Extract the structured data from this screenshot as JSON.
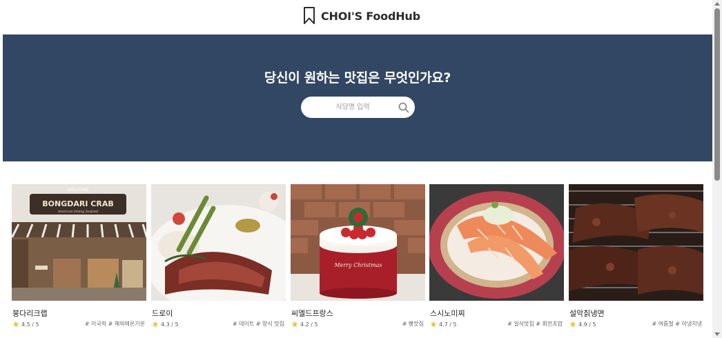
{
  "header": {
    "brand": "CHOI'S FoodHub",
    "brand_icon": "bookmark-icon"
  },
  "hero": {
    "title": "당신이 원하는 맛집은 무엇인가요?",
    "search_placeholder": "식당명 입력",
    "search_icon": "search-icon",
    "background": "#324763"
  },
  "restaurants": [
    {
      "name": "붕다리크랩",
      "rating": "4.5 / 5",
      "tags": "# 이국적 # 해외에온기분",
      "image_sign": "BONGDARI CRAB",
      "image_sign_top": "WELCOME",
      "image_sign_sub": "American Dining Seafood"
    },
    {
      "name": "드로이",
      "rating": "4.3 / 5",
      "tags": "# 데이트 # 양식 맛집"
    },
    {
      "name": "씨엘드프랑스",
      "rating": "4.2 / 5",
      "tags": "# 빵맛집",
      "image_text": "Merry Christmas"
    },
    {
      "name": "스시노미찌",
      "rating": "4.7 / 5",
      "tags": "# 일식맛집 # 회전초밥"
    },
    {
      "name": "설악칡냉면",
      "rating": "4.9 / 5",
      "tags": "# 여름철 # 이냉치냉"
    }
  ],
  "colors": {
    "star": "#f0c33c",
    "hero": "#324763"
  }
}
